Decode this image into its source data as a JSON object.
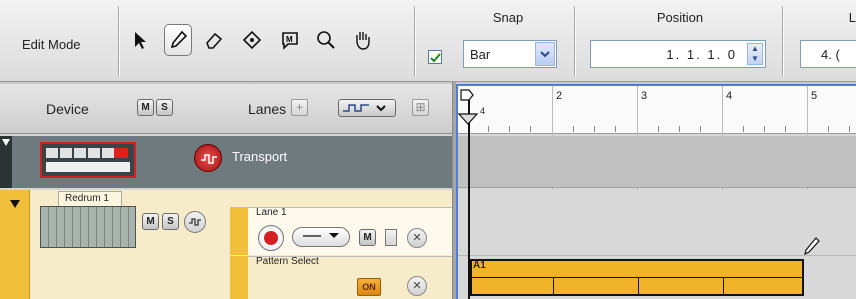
{
  "toolbar": {
    "edit_mode_label": "Edit Mode",
    "snap_label": "Snap",
    "snap_value": "Bar",
    "snap_checked": true,
    "position_label": "Position",
    "position_value": "1. 1. 1.   0",
    "length_label": "Le",
    "length_value": "4. ("
  },
  "device_header": {
    "device_label": "Device",
    "m_label": "M",
    "s_label": "S",
    "lanes_label": "Lanes"
  },
  "tracks": {
    "transport_name": "Transport",
    "redrum_name": "Redrum 1",
    "lane_name": "Lane 1",
    "m_label": "M",
    "s_label": "S",
    "lane_m_label": "M",
    "pattern_select_label": "Pattern Select",
    "on_label": "ON",
    "x_label": "✕"
  },
  "ruler": {
    "bars": [
      "2",
      "3",
      "4",
      "5"
    ],
    "marker_label": "4"
  },
  "clip": {
    "label": "A1"
  }
}
